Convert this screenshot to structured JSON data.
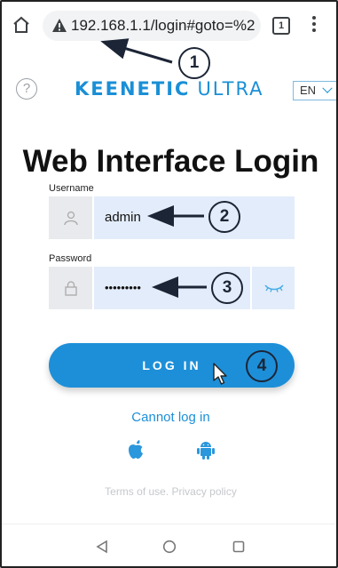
{
  "browser": {
    "url": "192.168.1.1/login#goto=%2",
    "tab_count": "1"
  },
  "header": {
    "brand_primary": "KEENETIC",
    "brand_secondary": "ULTRA",
    "language": "EN",
    "help_icon_glyph": "?"
  },
  "title": "Web Interface Login",
  "form": {
    "username_label": "Username",
    "username_value": "admin",
    "password_label": "Password",
    "password_value": "•••••••••",
    "login_button": "LOG IN"
  },
  "links": {
    "cannot_log_in": "Cannot log in",
    "terms": "Terms of use. Privacy policy"
  },
  "annotations": [
    "1",
    "2",
    "3",
    "4"
  ],
  "colors": {
    "accent": "#1d8fd8",
    "field_bg": "#e3ecfa",
    "annotation": "#1c2536"
  },
  "icons": [
    "home-icon",
    "warning-icon",
    "tabs-icon",
    "overflow-menu-icon",
    "help-icon",
    "user-icon",
    "lock-icon",
    "eye-closed-icon",
    "apple-icon",
    "android-icon",
    "back-icon",
    "home-circle-icon",
    "recents-icon",
    "mouse-cursor-icon"
  ]
}
